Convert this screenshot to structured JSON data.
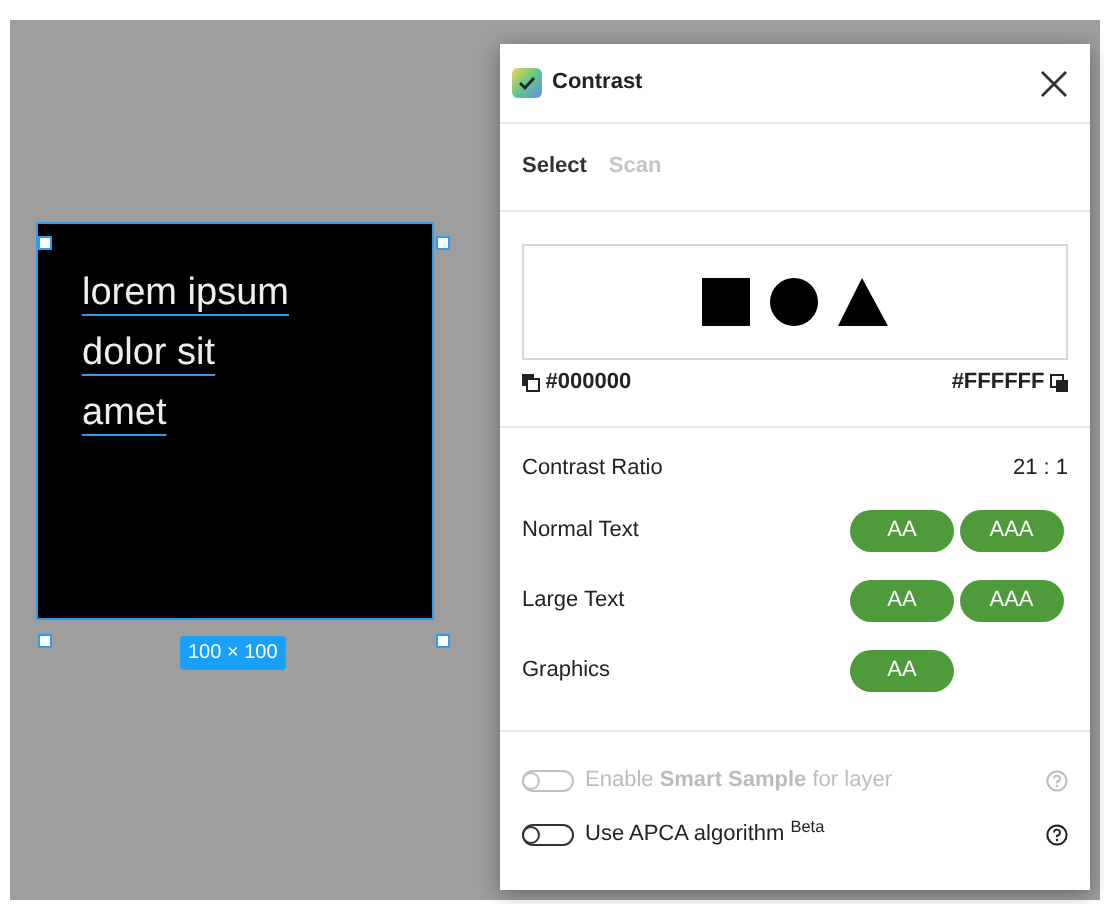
{
  "canvas": {
    "frame": {
      "text_lines": [
        "lorem ipsum",
        "dolor sit",
        "amet"
      ],
      "selected": true,
      "size_label": "100 × 100"
    }
  },
  "panel": {
    "title": "Contrast",
    "tabs": [
      {
        "label": "Select",
        "selected": true
      },
      {
        "label": "Scan",
        "selected": false
      }
    ],
    "preview": {
      "foreground": "#000000",
      "background": "#FFFFFF"
    },
    "ratio": {
      "label": "Contrast Ratio",
      "value": "21 : 1"
    },
    "checks": [
      {
        "label": "Normal Text",
        "badges": [
          {
            "label": "AA",
            "passed": true
          },
          {
            "label": "AAA",
            "passed": true
          }
        ]
      },
      {
        "label": "Large Text",
        "badges": [
          {
            "label": "AA",
            "passed": true
          },
          {
            "label": "AAA",
            "passed": true
          }
        ]
      },
      {
        "label": "Graphics",
        "badges": [
          {
            "label": "AA",
            "passed": true
          }
        ]
      }
    ],
    "options": [
      {
        "text": "Enable **Smart Sample** for layer",
        "on": false,
        "disabled": true
      },
      {
        "text": "Use APCA algorithm $^{Beta}$",
        "on": false,
        "disabled": false
      }
    ]
  }
}
